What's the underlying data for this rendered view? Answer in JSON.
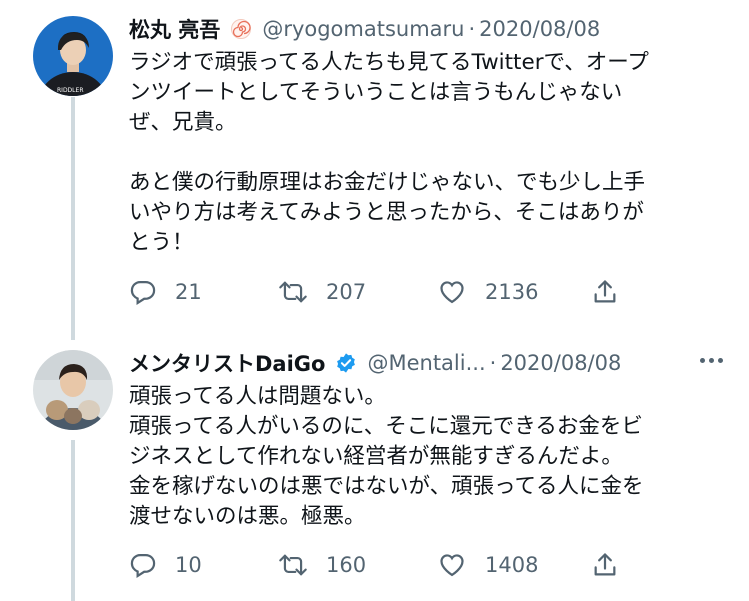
{
  "tweets": [
    {
      "name": "松丸 亮吾",
      "handle": "@ryogomatsumaru",
      "separator": "·",
      "date": "2020/08/08",
      "text": "ラジオで頑張ってる人たちも見てるTwitterで、オープ\nンツイートとしてそういうことは言うもんじゃない\nぜ、兄貴。\n\nあと僕の行動原理はお金だけじゃない、でも少し上手\nいやり方は考えてみようと思ったから、そこはありが\nとう！",
      "replies": "21",
      "retweets": "207",
      "likes": "2136",
      "avatar_shirt_text": "RIDDLER"
    },
    {
      "name": "メンタリストDaiGo",
      "handle": "@Mentali...",
      "separator": "·",
      "date": "2020/08/08",
      "text": "頑張ってる人は問題ない。\n頑張ってる人がいるのに、そこに還元できるお金をビ\nジネスとして作れない経営者が無能すぎるんだよ。\n金を稼げないのは悪ではないが、頑張ってる人に金を\n渡せないのは悪。極悪。",
      "replies": "10",
      "retweets": "160",
      "likes": "1408"
    }
  ],
  "icons": {
    "reply": "reply-icon",
    "retweet": "retweet-icon",
    "like": "heart-icon",
    "share": "share-icon",
    "verified": "verified-badge-icon",
    "emoji": "spiral-emoji-icon",
    "more": "more-icon"
  },
  "colors": {
    "text": "#0f1419",
    "secondary": "#536471",
    "verified": "#1d9bf0",
    "thread_line": "#cfd9de",
    "avatar1_bg": "#1d6fc4"
  }
}
